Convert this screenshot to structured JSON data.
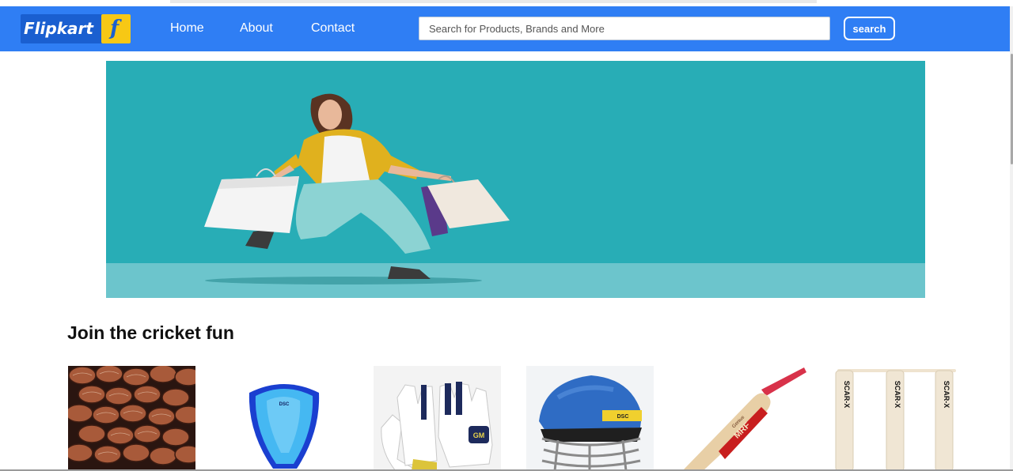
{
  "header": {
    "logo_text": "Flipkart",
    "logo_bag_letter": "f",
    "nav": [
      {
        "label": "Home"
      },
      {
        "label": "About"
      },
      {
        "label": "Contact"
      }
    ],
    "search": {
      "placeholder": "Search for Products, Brands and More",
      "value": "",
      "button_label": "search"
    }
  },
  "section": {
    "title": "Join the cricket fun"
  },
  "products": [
    {
      "icon": "cricket-balls-icon"
    },
    {
      "icon": "abdominal-guard-icon",
      "brand": "DSC"
    },
    {
      "icon": "batting-gloves-icon",
      "brand": "GM"
    },
    {
      "icon": "cricket-helmet-icon",
      "brand": "DSC"
    },
    {
      "icon": "cricket-bat-icon",
      "brand": "MRF",
      "sub_brand": "Genius"
    },
    {
      "icon": "cricket-stumps-icon",
      "brand": "SCAR-X"
    }
  ],
  "colors": {
    "navbar": "#2f7ef4",
    "banner_bg": "#28adb6",
    "logo_bag": "#f7c815"
  }
}
